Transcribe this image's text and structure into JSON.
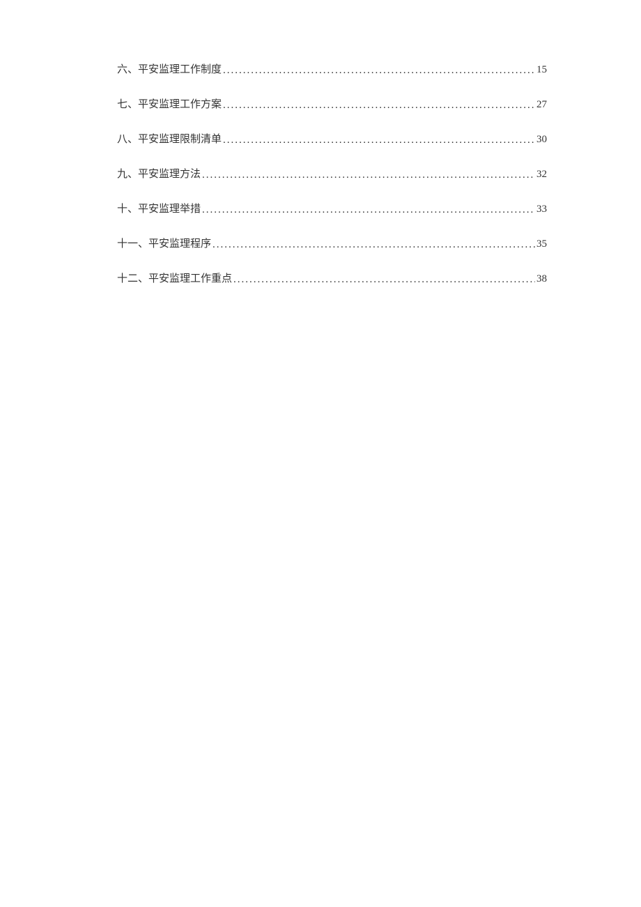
{
  "toc": {
    "entries": [
      {
        "title": "六、平安监理工作制度",
        "page": "15"
      },
      {
        "title": "七、平安监理工作方案",
        "page": "27"
      },
      {
        "title": "八、平安监理限制清单",
        "page": "30"
      },
      {
        "title": "九、平安监理方法",
        "page": "32"
      },
      {
        "title": "十、平安监理举措",
        "page": "33"
      },
      {
        "title": "十一、平安监理程序",
        "page": "35"
      },
      {
        "title": "十二、平安监理工作重点",
        "page": "38"
      }
    ]
  }
}
